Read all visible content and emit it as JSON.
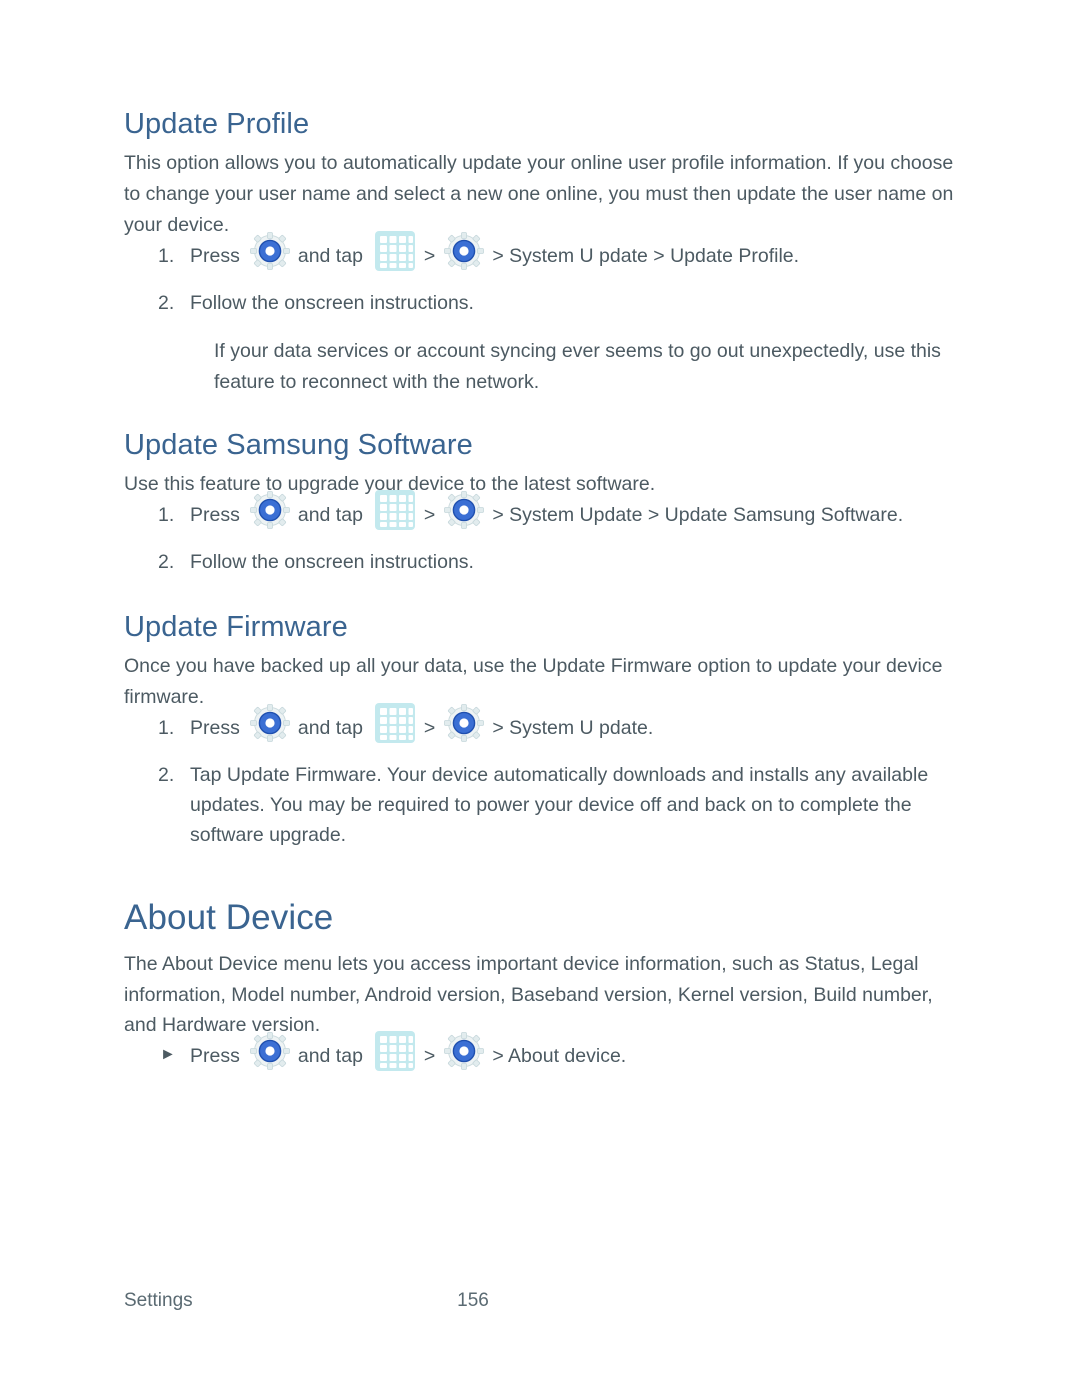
{
  "document": {
    "page_number": "156",
    "footer_section": "Settings",
    "colors": {
      "heading_blue": "#3a6490",
      "body_gray": "#4c5a62",
      "gear_ring_blue": "#2b5fc4",
      "grid_bg_cyan": "#bfe9ee"
    }
  },
  "sections": [
    {
      "id": "update-profile",
      "heading": "Update Profile",
      "intro": "This option allows you to automatically update your online user profile information. If you choose to change your user name and select a new one online, you must then update the user name on your device.",
      "steps": [
        {
          "marker": "1.",
          "before_gear": "Press",
          "between": "and tap",
          "after": "> System U pdate  > Update Profile."
        },
        {
          "marker": "2.",
          "text": "Follow the onscreen instructions."
        }
      ],
      "note": "If your data services or account syncing ever seems to go out unexpectedly, use this feature to reconnect with the network."
    },
    {
      "id": "update-samsung-software",
      "heading": "Update Samsung Software",
      "intro": "Use this feature to upgrade your device to the latest software.",
      "steps": [
        {
          "marker": "1.",
          "before_gear": "Press",
          "between": "and tap",
          "after": "> System Update >  Update Samsung Software."
        },
        {
          "marker": "2.",
          "text": "Follow the onscreen instructions."
        }
      ]
    },
    {
      "id": "update-firmware",
      "heading": "Update Firmware",
      "intro": "Once you have backed up all your data, use the Update Firmware option to update your device firmware.",
      "steps": [
        {
          "marker": "1.",
          "before_gear": "Press",
          "between": "and tap",
          "after": "> System U pdate."
        },
        {
          "marker": "2.",
          "text": "Tap Update Firmware. Your device automatically downloads and installs any available updates. You may be required to power your device off and back on to complete the software upgrade."
        }
      ]
    },
    {
      "id": "about-device",
      "heading": "About Device",
      "intro": "The About Device menu lets you access important device information, such as Status, Legal information, Model number, Android version, Baseband version, Kernel version, Build number, and Hardware version.",
      "steps": [
        {
          "marker": "►",
          "before_gear": "Press",
          "between": "and tap",
          "after": "> About  device."
        }
      ]
    }
  ],
  "icons": {
    "gear": "settings-gear-icon",
    "grid": "apps-grid-icon",
    "chevron": ">"
  }
}
